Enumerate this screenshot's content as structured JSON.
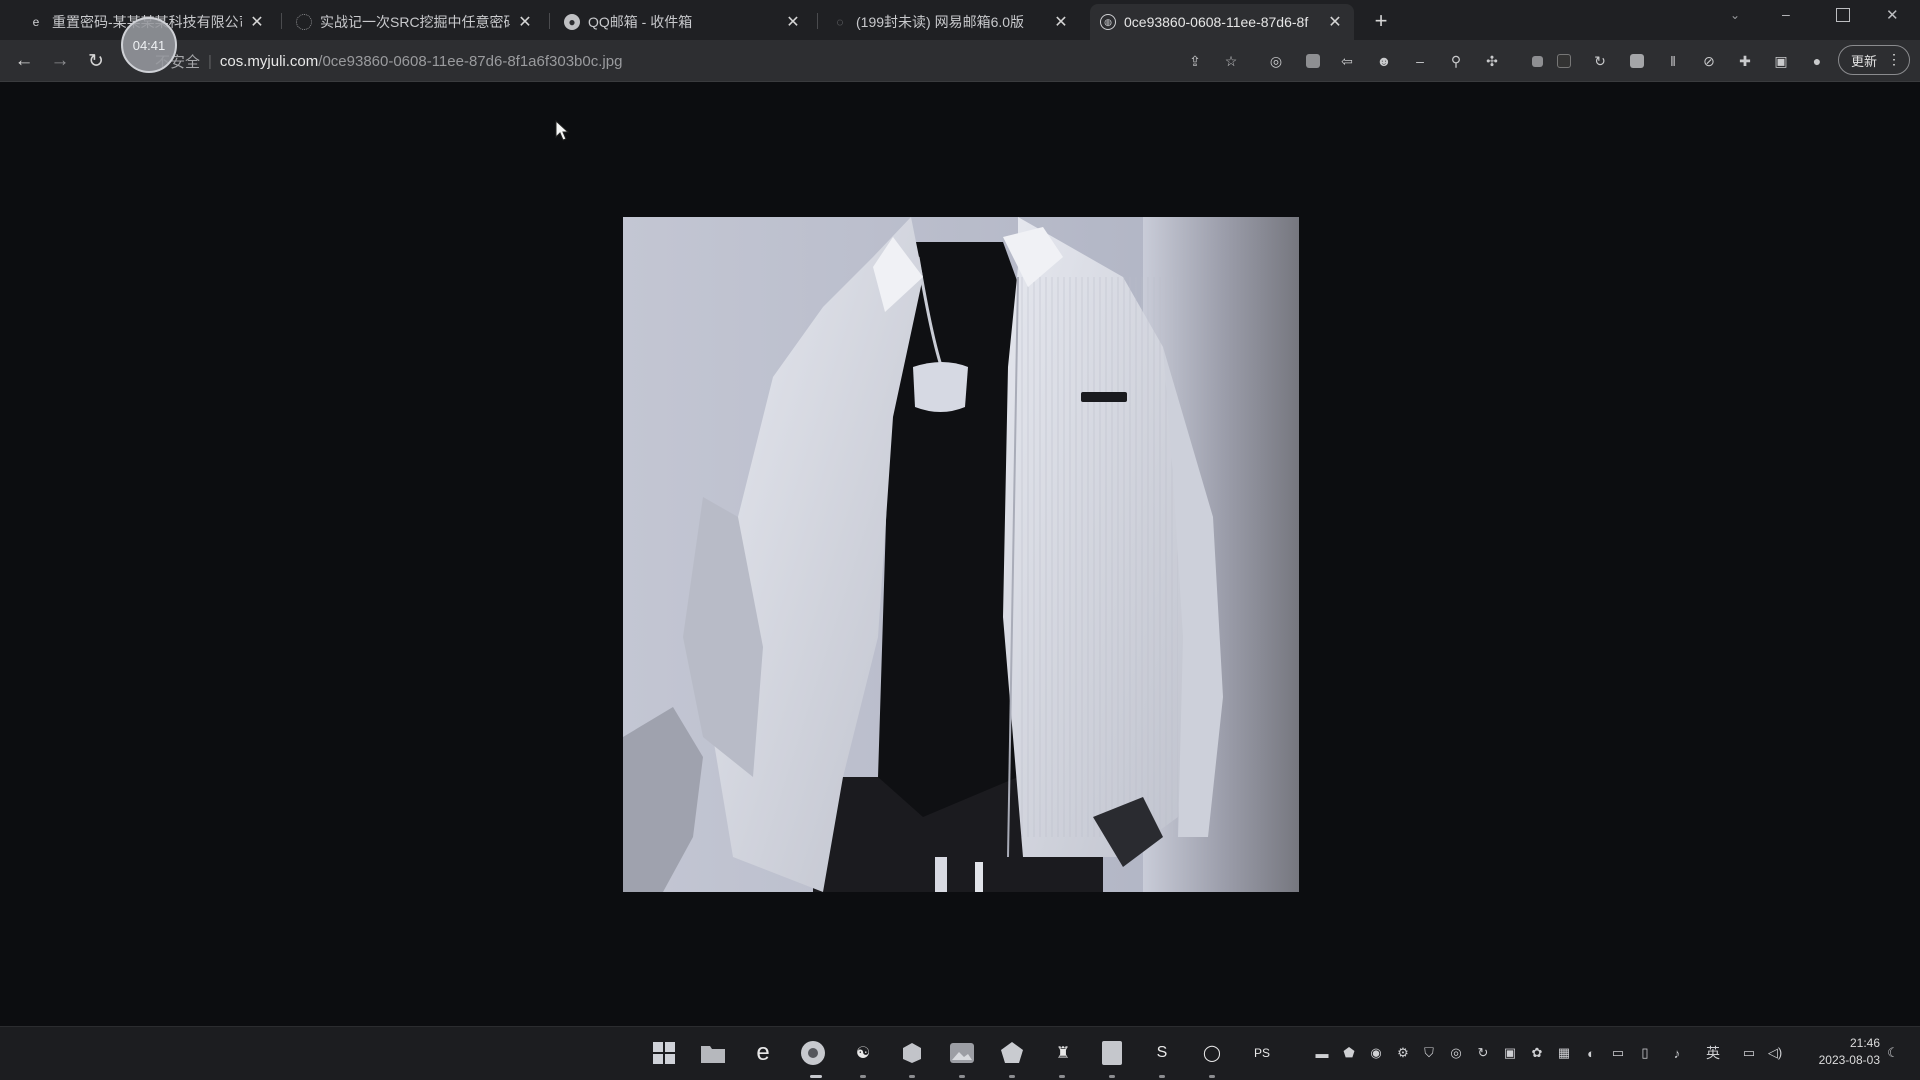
{
  "tabs": [
    {
      "title": "重置密码-某某某某科技有限公司",
      "favicon": "edge-e-icon"
    },
    {
      "title": "实战记一次SRC挖掘中任意密码",
      "favicon": "loading-icon"
    },
    {
      "title": "QQ邮箱 - 收件箱",
      "favicon": "qq-mail-icon"
    },
    {
      "title": "(199封未读) 网易邮箱6.0版",
      "favicon": "netease-mail-icon"
    },
    {
      "title": "0ce93860-0608-11ee-87d6-8f",
      "favicon": "globe-icon",
      "active": true
    }
  ],
  "recording_timer": "04:41",
  "omnibox": {
    "security_label": "不安全",
    "host": "cos.myjuli.com",
    "path": "/0ce93860-0608-11ee-87d6-8f1a6f303b0c.jpg"
  },
  "toolbar": {
    "update_label": "更新"
  },
  "image": {
    "alt": "0ce93860-0608-11ee-87d6-8f1a6f303b0c.jpg"
  },
  "taskbar": {
    "clock_time": "21:46",
    "clock_date": "2023-08-03",
    "ime_label": "英"
  },
  "colors": {
    "page_background": "#0c0d10",
    "tabstrip": "#1f2023",
    "toolbar": "#2d2e31",
    "taskbar": "#1c1d20"
  }
}
